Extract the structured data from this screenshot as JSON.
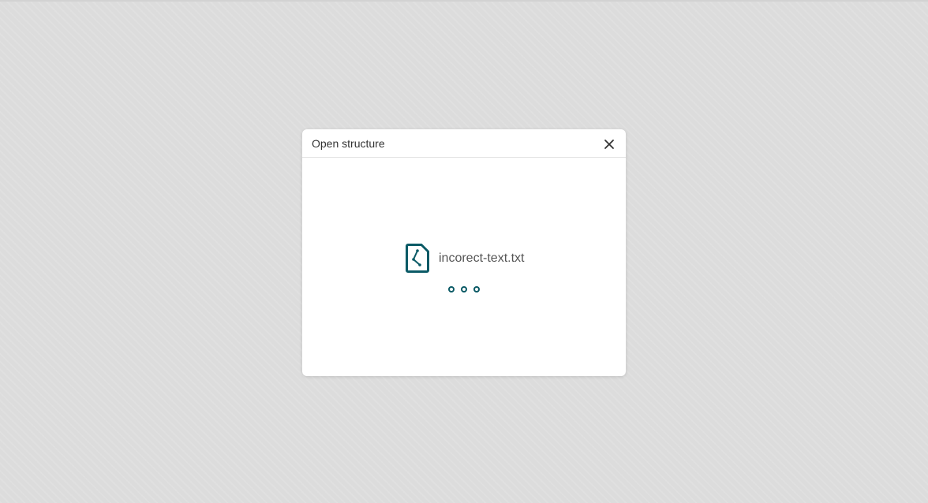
{
  "dialog": {
    "title": "Open structure",
    "close_icon": "close-icon"
  },
  "file": {
    "icon": "structure-file-icon",
    "name": "incorect-text.txt"
  },
  "loader": {
    "icon": "loading-dots-icon",
    "dots": 3
  },
  "colors": {
    "accent": "#0b5a66",
    "backdrop": "#dcdcdc",
    "dialog_background": "#ffffff",
    "title_text": "#333333",
    "file_text": "#555555"
  }
}
